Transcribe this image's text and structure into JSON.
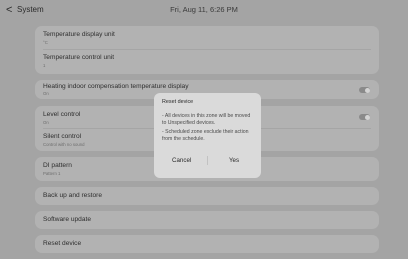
{
  "header": {
    "back_glyph": "<",
    "title": "System",
    "datetime": "Fri, Aug 11, 6:26 PM"
  },
  "temperature": {
    "display_unit_label": "Temperature display unit",
    "display_unit_value": "°C",
    "control_unit_label": "Temperature control unit",
    "control_unit_value": "1"
  },
  "heating": {
    "label": "Heating indoor compensation temperature display",
    "value": "On",
    "toggle_on": true
  },
  "level": {
    "label": "Level control",
    "value": "On",
    "toggle_on": true,
    "silent_label": "Silent control",
    "silent_value": "Control with no sound"
  },
  "di_pattern": {
    "label": "DI pattern",
    "value": "Pattern 1"
  },
  "menu": {
    "backup_label": "Back up and restore",
    "update_label": "Software update",
    "reset_label": "Reset device"
  },
  "dialog": {
    "title": "Reset device",
    "line1": "- All devices in this zone will be moved to Unspecified devices.",
    "line2": "- Scheduled zone exclude their action from the schedule.",
    "cancel_label": "Cancel",
    "yes_label": "Yes"
  },
  "colors": {
    "background_dimmed": "#a4a4a4",
    "card": "#b2b2b2",
    "dialog": "#dadada"
  }
}
